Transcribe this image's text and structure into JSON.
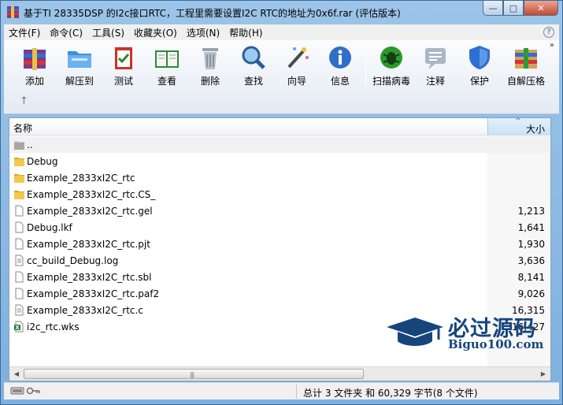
{
  "window": {
    "title": "基于TI 28335DSP 的I2c接口RTC，工程里需要设置I2C RTC的地址为0x6f.rar (评估版本)",
    "controls": {
      "minimize": "—",
      "maximize": "□",
      "close": "✕"
    }
  },
  "menu": {
    "items": [
      "文件(F)",
      "命令(C)",
      "工具(S)",
      "收藏夹(O)",
      "选项(N)",
      "帮助(H)"
    ],
    "extra": "?"
  },
  "toolbar": {
    "tools": [
      {
        "label": "添加",
        "icon": "books-add-icon"
      },
      {
        "label": "解压到",
        "icon": "folder-extract-icon"
      },
      {
        "label": "测试",
        "icon": "clipboard-check-icon"
      },
      {
        "label": "查看",
        "icon": "open-book-icon"
      },
      {
        "label": "删除",
        "icon": "trash-can-icon"
      },
      {
        "label": "查找",
        "icon": "magnifier-icon"
      },
      {
        "label": "向导",
        "icon": "magic-wand-icon"
      },
      {
        "label": "信息",
        "icon": "info-icon"
      },
      {
        "label": "扫描病毒",
        "icon": "virus-scan-icon"
      },
      {
        "label": "注释",
        "icon": "comment-icon"
      },
      {
        "label": "保护",
        "icon": "shield-icon"
      },
      {
        "label": "自解压格",
        "icon": "sfx-box-icon"
      }
    ],
    "more": "»",
    "up": "↑"
  },
  "columns": {
    "name": "名称",
    "size": "大小",
    "sort": "^"
  },
  "files": [
    {
      "name": "..",
      "size": "",
      "type": "parent"
    },
    {
      "name": "Debug",
      "size": "",
      "type": "folder"
    },
    {
      "name": "Example_2833xI2C_rtc",
      "size": "",
      "type": "folder"
    },
    {
      "name": "Example_2833xI2C_rtc.CS_",
      "size": "",
      "type": "folder"
    },
    {
      "name": "Example_2833xI2C_rtc.gel",
      "size": "1,213",
      "type": "file"
    },
    {
      "name": "Debug.lkf",
      "size": "1,641",
      "type": "file"
    },
    {
      "name": "Example_2833xI2C_rtc.pjt",
      "size": "1,930",
      "type": "file"
    },
    {
      "name": "cc_build_Debug.log",
      "size": "3,636",
      "type": "text"
    },
    {
      "name": "Example_2833xI2C_rtc.sbl",
      "size": "8,141",
      "type": "file"
    },
    {
      "name": "Example_2833xI2C_rtc.paf2",
      "size": "9,026",
      "type": "file"
    },
    {
      "name": "Example_2833xI2C_rtc.c",
      "size": "16,315",
      "type": "text"
    },
    {
      "name": "i2c_rtc.wks",
      "size": "16,427",
      "type": "excel"
    }
  ],
  "status": {
    "summary": "总计 3 文件夹 和 60,329 字节(8 个文件)"
  },
  "watermark": {
    "cn": "必过源码",
    "en": "Biguo100.com"
  },
  "colors": {
    "title_gradient_top": "#9cc4e8",
    "brand": "#16457c",
    "folder": "#e8b93a"
  }
}
